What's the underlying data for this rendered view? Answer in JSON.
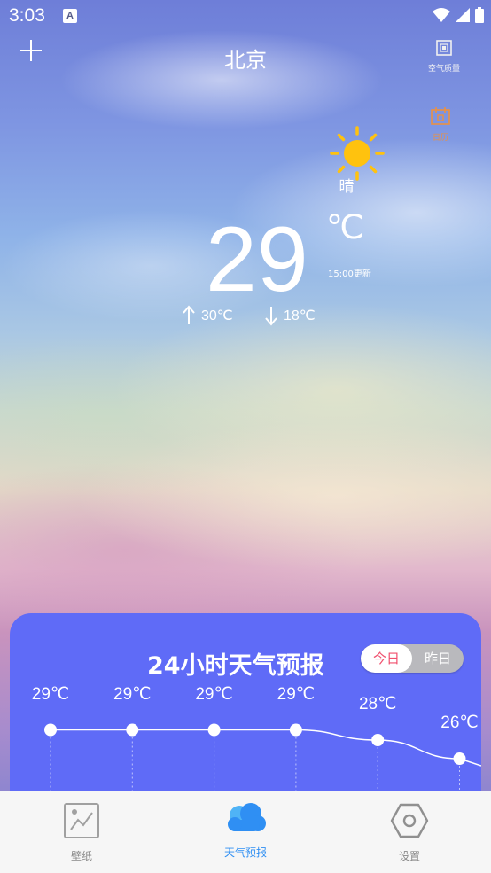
{
  "status_bar": {
    "time": "3:03",
    "app_badge": "A"
  },
  "header": {
    "city": "北京",
    "aqi_label": "空气质量",
    "calendar_label": "日历"
  },
  "weather": {
    "condition": "晴",
    "temperature": "29",
    "unit": "℃",
    "updated": "15:00更新",
    "high": "30℃",
    "low": "18℃",
    "icon": "sun-icon"
  },
  "forecast": {
    "title": "24小时天气预报",
    "toggle_today": "今日",
    "toggle_yesterday": "昨日",
    "hours": [
      {
        "temp": "29℃",
        "value": 29
      },
      {
        "temp": "29℃",
        "value": 29
      },
      {
        "temp": "29℃",
        "value": 29
      },
      {
        "temp": "29℃",
        "value": 29
      },
      {
        "temp": "28℃",
        "value": 28
      },
      {
        "temp": "26℃",
        "value": 26
      }
    ]
  },
  "nav": {
    "wallpaper": "壁纸",
    "weather": "天气预报",
    "settings": "设置"
  },
  "colors": {
    "card_bg": "#5f6bf7",
    "active_nav": "#2f8ff3",
    "toggle_active_text": "#f0506e",
    "sun": "#ffc20e",
    "calendar_icon": "#e99144"
  }
}
